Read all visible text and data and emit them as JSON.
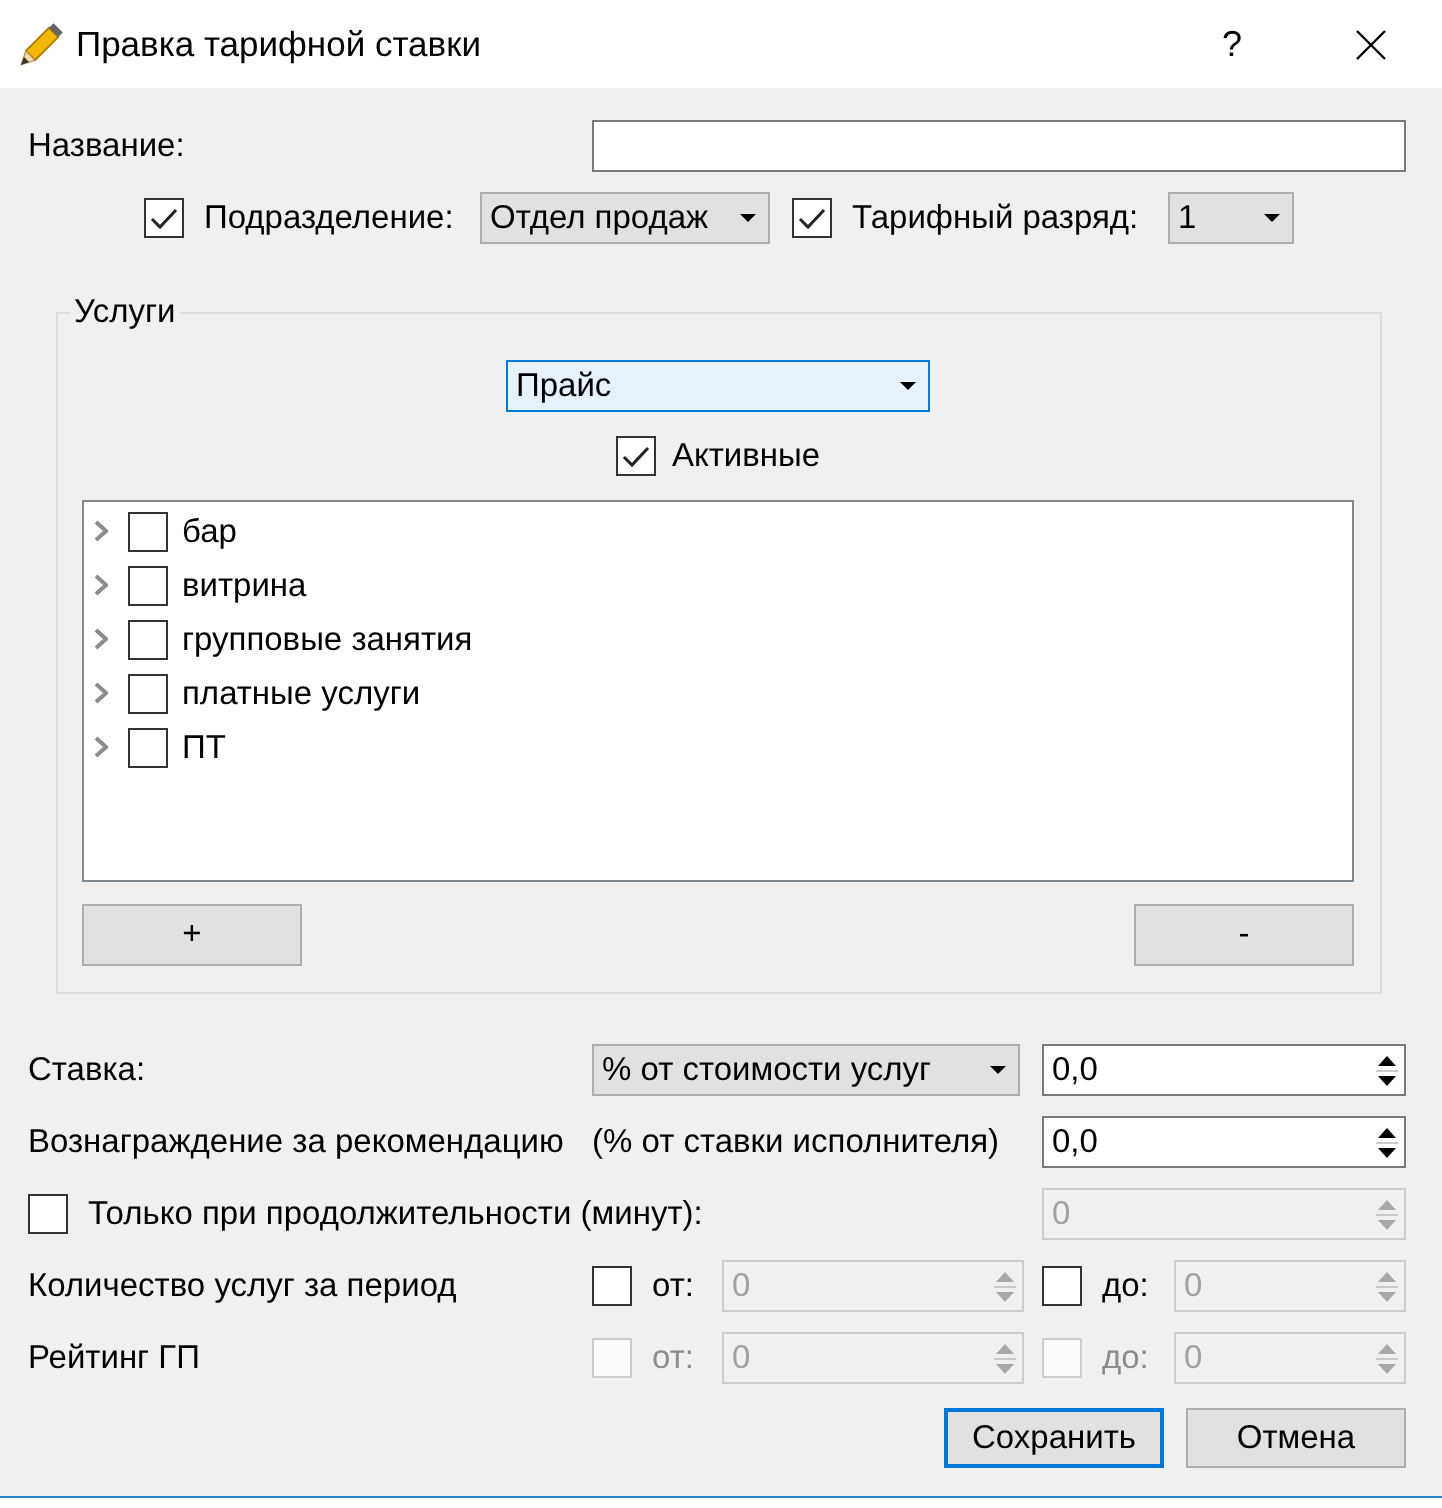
{
  "window": {
    "title": "Правка тарифной ставки",
    "help": "?"
  },
  "name": {
    "label": "Название:"
  },
  "filters": [
    {
      "label": "Подразделение:",
      "checked": true,
      "value": "Отдел продаж"
    },
    {
      "label": "Тарифный разряд:",
      "checked": true,
      "value": "1"
    }
  ],
  "services": {
    "title": "Услуги",
    "price_list": {
      "value": "Прайс",
      "focused": true
    },
    "active": {
      "label": "Активные",
      "checked": true
    },
    "tree": [
      {
        "label": "бар",
        "checked": false,
        "expanded": false
      },
      {
        "label": "витрина",
        "checked": false,
        "expanded": false
      },
      {
        "label": "групповые занятия",
        "checked": false,
        "expanded": false
      },
      {
        "label": "платные услуги",
        "checked": false,
        "expanded": false
      },
      {
        "label": "ПТ",
        "checked": false,
        "expanded": false
      }
    ],
    "buttons": [
      {
        "label": "+"
      },
      {
        "label": "-"
      }
    ]
  },
  "rate": {
    "label": "Ставка:",
    "type": "% от стоимости услуг",
    "value": "0,0"
  },
  "referral": {
    "label": "Вознаграждение за рекомендацию",
    "note": "(% от ставки исполнителя)",
    "value": "0,0"
  },
  "duration": {
    "label": "Только при продолжительности (минут):",
    "checked": false,
    "value": "0"
  },
  "ranges": [
    {
      "label": "Количество услуг за период",
      "from": {
        "label": "от:",
        "checked": false,
        "disabled": false,
        "value": "0"
      },
      "to": {
        "label": "до:",
        "checked": false,
        "disabled": false,
        "value": "0"
      }
    },
    {
      "label": "Рейтинг ГП",
      "from": {
        "label": "от:",
        "checked": false,
        "disabled": true,
        "value": "0"
      },
      "to": {
        "label": "до:",
        "checked": false,
        "disabled": true,
        "value": "0"
      }
    }
  ],
  "actions": [
    {
      "label": "Сохранить",
      "default": true
    },
    {
      "label": "Отмена",
      "default": false
    }
  ]
}
